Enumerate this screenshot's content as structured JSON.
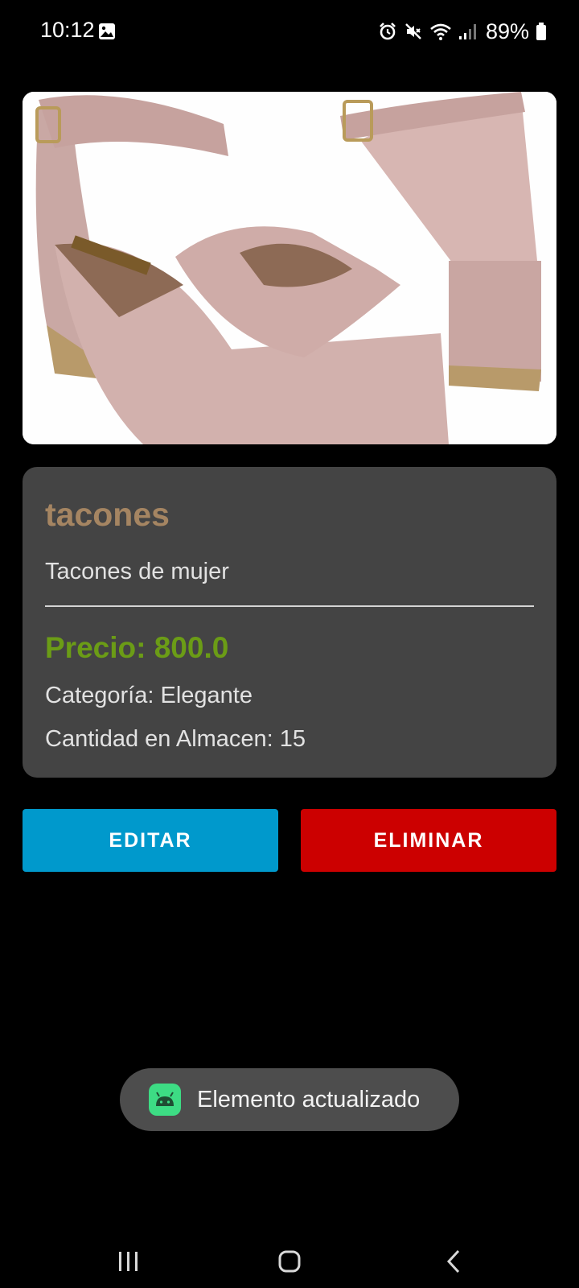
{
  "status_bar": {
    "time": "10:12",
    "battery": "89%",
    "icons": [
      "gallery-icon",
      "alarm-icon",
      "mute-icon",
      "wifi-icon",
      "signal-icon",
      "battery-icon"
    ]
  },
  "product": {
    "image_alt": "pink block-heel ankle-strap shoes",
    "name": "tacones",
    "description": "Tacones de mujer",
    "price": "Precio: 800.0",
    "category": "Categoría: Elegante",
    "stock": "Cantidad en Almacen: 15"
  },
  "actions": {
    "edit_label": "EDITAR",
    "delete_label": "ELIMINAR"
  },
  "toast": {
    "message": "Elemento actualizado",
    "icon": "android-icon"
  },
  "nav": {
    "icons": [
      "recents-icon",
      "home-icon",
      "back-icon"
    ]
  },
  "colors": {
    "name": "#a58562",
    "price": "#6b9c16",
    "edit_button": "#0099cc",
    "delete_button": "#cc0000",
    "card": "#444444"
  }
}
